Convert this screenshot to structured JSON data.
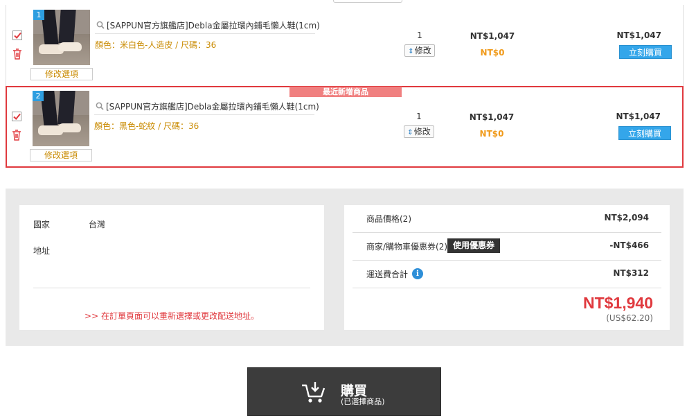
{
  "cart": {
    "items": [
      {
        "index": "1",
        "title": "[SAPPUN官方旗艦店]Debla金屬拉環內鋪毛懶人鞋(1cm)",
        "options": "顏色：米白色-人造皮 / 尺碼：36",
        "edit_options_label": "修改選項",
        "quantity": "1",
        "qty_edit_label": "修改",
        "unit_price": "NT$1,047",
        "discount": "NT$0",
        "subtotal": "NT$1,047",
        "buy_now_label": "立刻購買",
        "checked": true
      },
      {
        "index": "2",
        "title": "[SAPPUN官方旗艦店]Debla金屬拉環內鋪毛懶人鞋(1cm)",
        "options": "顏色：黑色-蛇紋 / 尺碼：36",
        "edit_options_label": "修改選項",
        "quantity": "1",
        "qty_edit_label": "修改",
        "unit_price": "NT$1,047",
        "discount": "NT$0",
        "subtotal": "NT$1,047",
        "buy_now_label": "立刻購買",
        "checked": true,
        "tag": "最近新增商品"
      }
    ]
  },
  "address": {
    "country_label": "國家",
    "country_value": "台灣",
    "address_label": "地址",
    "note": ">> 在訂單頁面可以重新選擇或更改配送地址。"
  },
  "pricing": {
    "product_label": "商品價格(2)",
    "product_value": "NT$2,094",
    "coupon_label": "商家/購物車優惠券(2)",
    "coupon_button": "使用優惠券",
    "coupon_value": "-NT$466",
    "shipping_label": "運送費合計",
    "shipping_value": "NT$312",
    "total": "NT$1,940",
    "total_usd": "(US$62.20)"
  },
  "checkout": {
    "main_label": "購買",
    "sub_label": "(已選擇商品)"
  },
  "icons": {
    "checkbox": "checkbox-checked-icon",
    "trash": "trash-icon",
    "search": "search-icon",
    "spinner": "spinner-icon",
    "info": "info-icon",
    "cart": "cart-download-icon"
  },
  "colors": {
    "accent_red": "#e0393e",
    "buy_blue": "#34a6ea",
    "option_orange": "#c98a00",
    "discount_orange": "#f09a1a",
    "checkout_dark": "#3c3c3c"
  }
}
